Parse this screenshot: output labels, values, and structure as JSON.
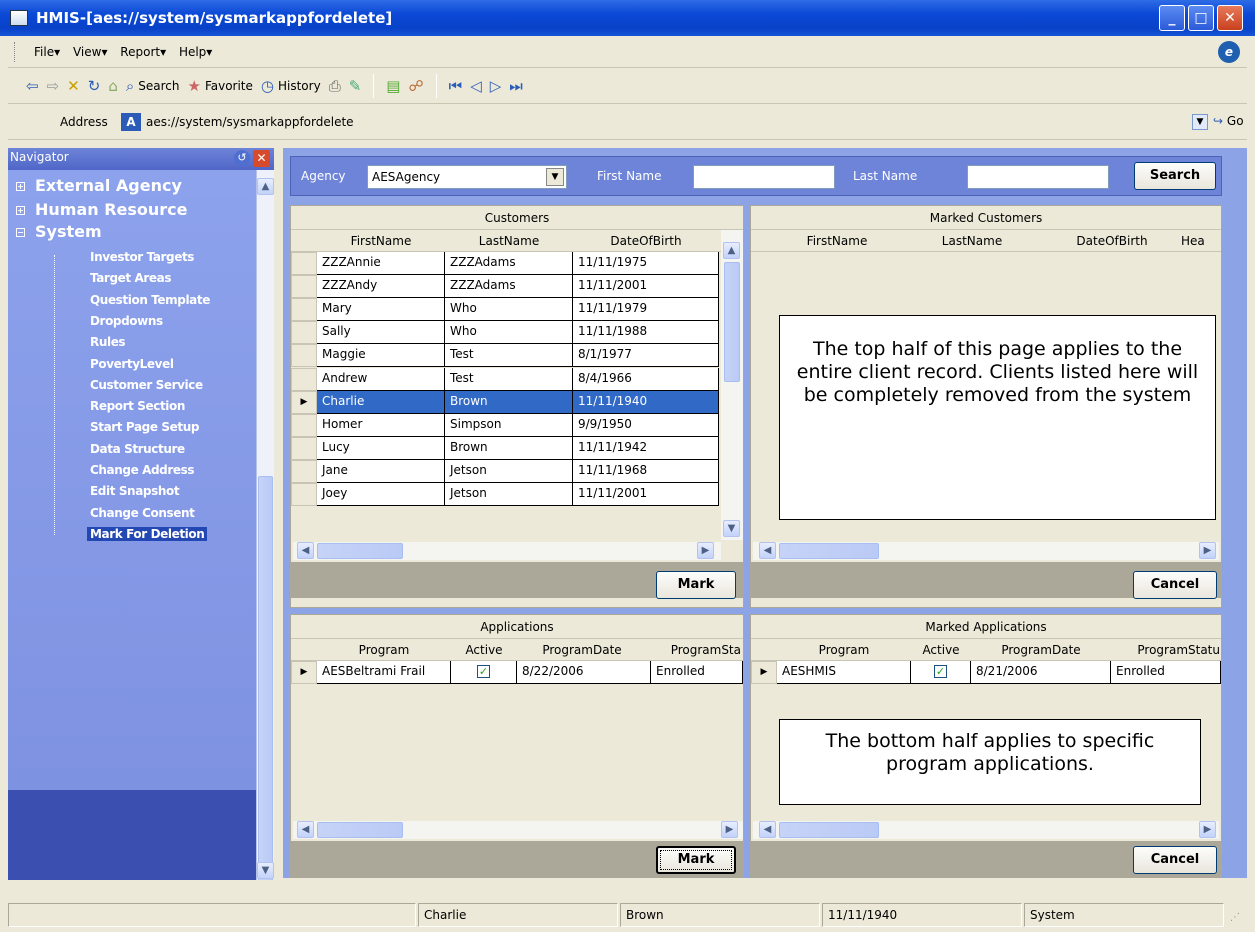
{
  "window": {
    "title": "HMIS-[aes://system/sysmarkappfordelete]"
  },
  "menu": [
    "File",
    "View",
    "Report",
    "Help"
  ],
  "toolbar": {
    "search": "Search",
    "favorite": "Favorite",
    "history": "History"
  },
  "address": {
    "label": "Address",
    "value": "aes://system/sysmarkappfordelete",
    "go": "Go"
  },
  "navigator": {
    "title": "Navigator",
    "top_items": [
      "External Agency",
      "Human Resource",
      "System"
    ],
    "system_items": [
      "Investor Targets",
      "Target Areas",
      "Question Template",
      "Dropdowns",
      "Rules",
      "PovertyLevel",
      "Customer Service",
      "Report Section",
      "Start Page Setup",
      "Data Structure",
      "Change Address",
      "Edit Snapshot",
      "Change Consent",
      "Mark For Deletion"
    ],
    "selected": "Mark For Deletion"
  },
  "search": {
    "agency_label": "Agency",
    "agency_value": "AESAgency",
    "first_name_label": "First Name",
    "last_name_label": "Last Name",
    "button": "Search"
  },
  "customers": {
    "title": "Customers",
    "columns": [
      "FirstName",
      "LastName",
      "DateOfBirth"
    ],
    "rows": [
      [
        "ZZZAnnie",
        "ZZZAdams",
        "11/11/1975"
      ],
      [
        "ZZZAndy",
        "ZZZAdams",
        "11/11/2001"
      ],
      [
        "Mary",
        "Who",
        "11/11/1979"
      ],
      [
        "Sally",
        "Who",
        "11/11/1988"
      ],
      [
        "Maggie",
        "Test",
        "8/1/1977"
      ],
      [
        "Andrew",
        "Test",
        "8/4/1966"
      ],
      [
        "Charlie",
        "Brown",
        "11/11/1940"
      ],
      [
        "Homer",
        "Simpson",
        "9/9/1950"
      ],
      [
        "Lucy",
        "Brown",
        "11/11/1942"
      ],
      [
        "Jane",
        "Jetson",
        "11/11/1968"
      ],
      [
        "Joey",
        "Jetson",
        "11/11/2001"
      ]
    ],
    "selected_index": 6,
    "button": "Mark"
  },
  "marked_customers": {
    "title": "Marked Customers",
    "columns": [
      "FirstName",
      "LastName",
      "DateOfBirth",
      "Hea"
    ],
    "button": "Cancel",
    "note": "The top half of this page applies to the entire client record.  Clients listed here will be completely removed from the system"
  },
  "applications": {
    "title": "Applications",
    "columns": [
      "Program",
      "Active",
      "ProgramDate",
      "ProgramSta"
    ],
    "rows": [
      [
        "AESBeltrami Frail",
        "checked",
        "8/22/2006",
        "Enrolled"
      ]
    ],
    "button": "Mark"
  },
  "marked_applications": {
    "title": "Marked Applications",
    "columns": [
      "Program",
      "Active",
      "ProgramDate",
      "ProgramStatu"
    ],
    "rows": [
      [
        "AESHMIS",
        "checked",
        "8/21/2006",
        "Enrolled"
      ]
    ],
    "button": "Cancel",
    "note": "The bottom half applies to specific program applications."
  },
  "status": [
    "Charlie",
    "Brown",
    "11/11/1940",
    "System"
  ]
}
